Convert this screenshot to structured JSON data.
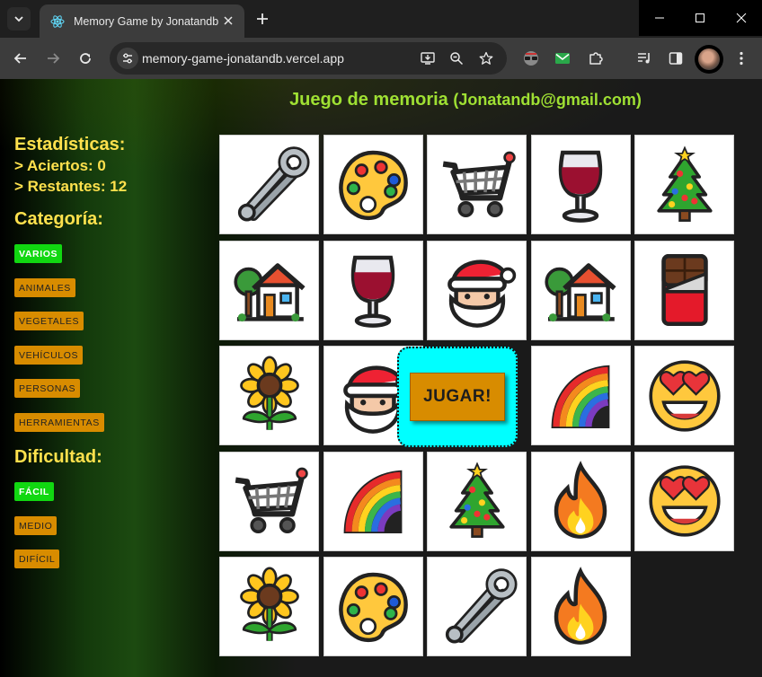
{
  "browser": {
    "tab_title": "Memory Game by Jonatandb",
    "url": "memory-game-jonatandb.vercel.app"
  },
  "page": {
    "title": "Juego de memoria",
    "email": "(Jonatandb@gmail.com)",
    "stats": {
      "heading": "Estadísticas:",
      "hits": "> Aciertos: 0",
      "remaining": "> Restantes: 12"
    },
    "category": {
      "heading": "Categoría:",
      "items": [
        {
          "label": "VARIOS",
          "active": true
        },
        {
          "label": "ANIMALES",
          "active": false
        },
        {
          "label": "VEGETALES",
          "active": false
        },
        {
          "label": "VEHÍCULOS",
          "active": false
        },
        {
          "label": "PERSONAS",
          "active": false
        },
        {
          "label": "HERRAMIENTAS",
          "active": false
        }
      ]
    },
    "difficulty": {
      "heading": "Dificultad:",
      "items": [
        {
          "label": "FÁCIL",
          "active": true
        },
        {
          "label": "MEDIO",
          "active": false
        },
        {
          "label": "DIFÍCIL",
          "active": false
        }
      ]
    },
    "play_label": "JUGAR!",
    "cards": [
      "safety-pin",
      "palette",
      "cart",
      "wine",
      "tree",
      "house",
      "wine",
      "santa",
      "house",
      "chocolate",
      "sunflower",
      "santa",
      "hidden",
      "rainbow",
      "heart-eyes",
      "cart",
      "rainbow",
      "tree",
      "fire",
      "heart-eyes",
      "sunflower",
      "palette",
      "safety-pin",
      "fire"
    ]
  },
  "colors": {
    "title_green": "#9fe033",
    "heading_yellow": "#ffe14d",
    "active_green": "#11d811",
    "button_orange": "#d88c00",
    "play_cyan": "#00ffff"
  }
}
